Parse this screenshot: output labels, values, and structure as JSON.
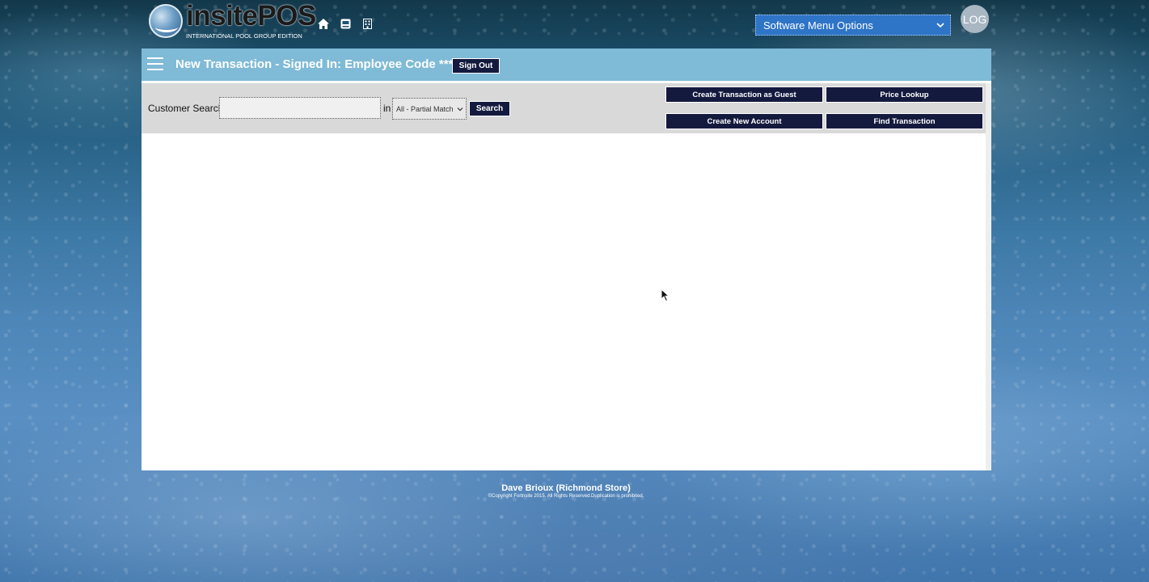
{
  "branding": {
    "logo_word": "insitePOS",
    "logo_subtitle": "INTERNATIONAL POOL GROUP EDITION"
  },
  "top_nav": {
    "icons": [
      "home-icon",
      "register-icon",
      "building-icon"
    ],
    "software_menu": "Software Menu Options",
    "log_button": "LOG"
  },
  "header": {
    "title": "New Transaction - Signed In: Employee Code ****",
    "sign_out": "Sign Out"
  },
  "search": {
    "label": "Customer Search",
    "input_value": "",
    "in_label": "in",
    "match_option": "All - Partial Match",
    "button": "Search"
  },
  "actions": {
    "create_guest": "Create Transaction as Guest",
    "price_lookup": "Price Lookup",
    "create_account": "Create New Account",
    "find_transaction": "Find Transaction"
  },
  "footer": {
    "user_store": "Dave Brioux (Richmond Store)",
    "copyright": "©Copyright Fortnsite 2015. All Rights Reserved.Duplication is prohibited."
  },
  "colors": {
    "header_bar": "#7fbad6",
    "button_navy": "#141a3e",
    "menu_blue": "#2e74c7"
  }
}
